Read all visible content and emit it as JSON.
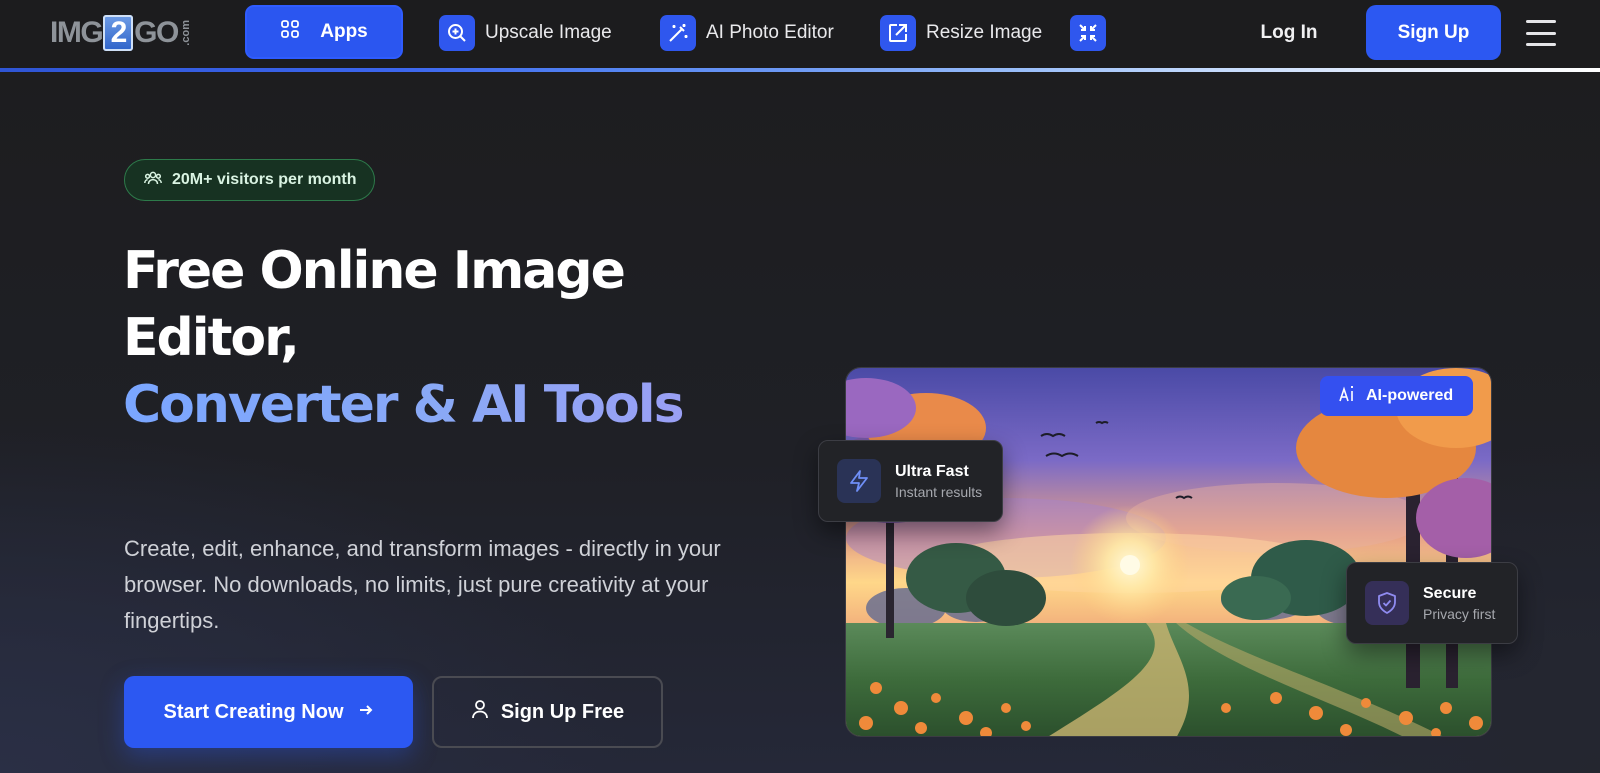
{
  "nav": {
    "logo": {
      "pre": "IMG",
      "mid": "2",
      "post": "GO",
      "suffix": ".com"
    },
    "apps_label": "Apps",
    "links": [
      {
        "label": "Upscale Image",
        "icon": "zoom-in-icon"
      },
      {
        "label": "AI Photo Editor",
        "icon": "magic-wand-icon"
      },
      {
        "label": "Resize Image",
        "icon": "resize-icon"
      },
      {
        "label": "",
        "icon": "compress-icon"
      }
    ],
    "login_label": "Log In",
    "signup_label": "Sign Up"
  },
  "hero": {
    "badge": "20M+ visitors per month",
    "title_line1": "Free Online Image Editor,",
    "title_line2": "Converter & AI Tools",
    "subtitle": "Create, edit, enhance, and transform images - directly in your browser. No downloads, no limits, just pure creativity at your fingertips.",
    "cta_primary": "Start Creating Now",
    "cta_secondary": "Sign Up Free"
  },
  "illustration": {
    "ai_pill": "AI-powered",
    "fast_card": {
      "title": "Ultra Fast",
      "sub": "Instant results"
    },
    "secure_card": {
      "title": "Secure",
      "sub": "Privacy first"
    }
  },
  "colors": {
    "accent": "#2c58f2",
    "badge_green": "#2d7a4a",
    "gradient_text": "#7aa6ff"
  }
}
